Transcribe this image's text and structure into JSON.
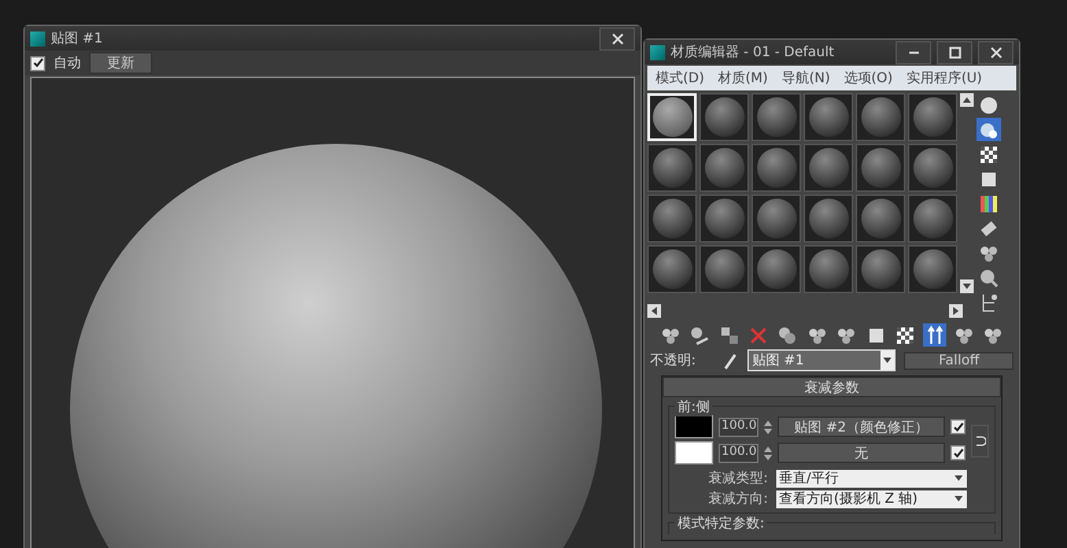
{
  "map_window": {
    "title": "贴图 #1",
    "auto": {
      "label": "自动",
      "checked": true
    },
    "update_button": "更新"
  },
  "material_editor": {
    "title": "材质编辑器 - 01 - Default",
    "menu": [
      "模式(D)",
      "材质(M)",
      "导航(N)",
      "选项(O)",
      "实用程序(U)"
    ],
    "slots": [
      {
        "selected": true
      },
      {
        "selected": false
      },
      {
        "selected": false
      },
      {
        "selected": false
      },
      {
        "selected": false
      },
      {
        "selected": false
      },
      {
        "selected": false
      },
      {
        "selected": false
      },
      {
        "selected": false
      },
      {
        "selected": false
      },
      {
        "selected": false
      },
      {
        "selected": false
      },
      {
        "selected": false
      },
      {
        "selected": false
      },
      {
        "selected": false
      },
      {
        "selected": false
      },
      {
        "selected": false
      },
      {
        "selected": false
      },
      {
        "selected": false
      },
      {
        "selected": false
      },
      {
        "selected": false
      },
      {
        "selected": false
      },
      {
        "selected": false
      },
      {
        "selected": false
      }
    ],
    "side_tools": [
      {
        "kind": "sphere",
        "selected": false
      },
      {
        "kind": "backlight",
        "selected": true
      },
      {
        "kind": "checker",
        "selected": false
      },
      {
        "kind": "square",
        "selected": false
      },
      {
        "kind": "bars",
        "selected": false
      },
      {
        "kind": "sample",
        "selected": false
      },
      {
        "kind": "spheres",
        "selected": false
      },
      {
        "kind": "magnify",
        "selected": false
      },
      {
        "kind": "tree",
        "selected": false
      }
    ],
    "tools": [
      {
        "kind": "spheres",
        "selected": false
      },
      {
        "kind": "put",
        "selected": false
      },
      {
        "kind": "assign",
        "selected": false
      },
      {
        "kind": "delete",
        "selected": false
      },
      {
        "kind": "copy",
        "selected": false
      },
      {
        "kind": "spheres",
        "selected": false
      },
      {
        "kind": "spheres",
        "selected": false
      },
      {
        "kind": "square",
        "selected": false
      },
      {
        "kind": "checker",
        "selected": false
      },
      {
        "kind": "arrows",
        "selected": true
      },
      {
        "kind": "spheres",
        "selected": false
      },
      {
        "kind": "spheres",
        "selected": false
      }
    ],
    "opacity_label": "不透明:",
    "map_name": "贴图 #1",
    "type_button": "Falloff",
    "rollout": {
      "title": "衰减参数",
      "group": "前:侧",
      "rows": [
        {
          "color": "#000000",
          "amount": "100.0",
          "map": "贴图 #2（颜色修正）",
          "checked": true
        },
        {
          "color": "#ffffff",
          "amount": "100.0",
          "map": "无",
          "checked": true
        }
      ],
      "fields": [
        {
          "label": "衰减类型:",
          "value": "垂直/平行"
        },
        {
          "label": "衰减方向:",
          "value": "查看方向(摄影机 Z 轴)"
        }
      ],
      "next_group": "模式特定参数:"
    }
  }
}
